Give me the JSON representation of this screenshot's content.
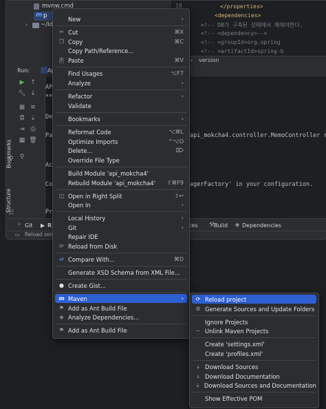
{
  "project_tree": {
    "file_name": "mvnw.cmd",
    "selected_item_prefix": "p",
    "folder_item": "~/Id"
  },
  "editor": {
    "line_number": "18",
    "lines": [
      "</properties>",
      "<dependencies>",
      "<!--      DB가 구축된 상태에서 해줘야한다.",
      "<!--      <dependency>-->",
      "<!--        <groupId>org.spring",
      "<!--        <artifactId>spring-b"
    ],
    "breadcrumb": "version"
  },
  "run_panel": {
    "label": "Run:",
    "tab_prefix": "Ap",
    "console_fragments": [
      "AP",
      "**",
      "De",
      "Pa",
      "api_mokcha4.controller.MemoController r",
      "Ac",
      "Co",
      "agerFactory' in your configuration.",
      "Pr"
    ]
  },
  "side_labels": {
    "bookmarks": "Bookmarks",
    "structure": "Structure"
  },
  "bottom_tabs": {
    "git": "Git",
    "run_prefix": "R",
    "services_suffix": "ces",
    "build": "Build",
    "dependencies": "Dependencies"
  },
  "status_bar": {
    "text": "Reload sele"
  },
  "context_menu": {
    "items": [
      {
        "label": "New",
        "shortcut": "",
        "submenu": true,
        "icon": ""
      },
      {
        "label": "Cut",
        "shortcut": "⌘X",
        "submenu": false,
        "icon": "scissors-icon"
      },
      {
        "label": "Copy",
        "shortcut": "⌘C",
        "submenu": false,
        "icon": "copy-icon"
      },
      {
        "label": "Copy Path/Reference...",
        "shortcut": "",
        "submenu": false,
        "icon": ""
      },
      {
        "label": "Paste",
        "shortcut": "⌘V",
        "submenu": false,
        "icon": "paste-icon"
      },
      {
        "label": "Find Usages",
        "shortcut": "⌥F7",
        "submenu": false,
        "icon": ""
      },
      {
        "label": "Analyze",
        "shortcut": "",
        "submenu": true,
        "icon": ""
      },
      {
        "label": "Refactor",
        "shortcut": "",
        "submenu": true,
        "icon": ""
      },
      {
        "label": "Validate",
        "shortcut": "",
        "submenu": false,
        "icon": ""
      },
      {
        "label": "Bookmarks",
        "shortcut": "",
        "submenu": true,
        "icon": ""
      },
      {
        "label": "Reformat Code",
        "shortcut": "⌥⌘L",
        "submenu": false,
        "icon": ""
      },
      {
        "label": "Optimize Imports",
        "shortcut": "^⌥O",
        "submenu": false,
        "icon": ""
      },
      {
        "label": "Delete...",
        "shortcut": "⌦",
        "submenu": false,
        "icon": ""
      },
      {
        "label": "Override File Type",
        "shortcut": "",
        "submenu": false,
        "icon": ""
      },
      {
        "label": "Build Module 'api_mokcha4'",
        "shortcut": "",
        "submenu": false,
        "icon": ""
      },
      {
        "label": "Rebuild Module 'api_mokcha4'",
        "shortcut": "⇧⌘F9",
        "submenu": false,
        "icon": ""
      },
      {
        "label": "Open in Right Split",
        "shortcut": "⇧↩",
        "submenu": false,
        "icon": "split-icon"
      },
      {
        "label": "Open In",
        "shortcut": "",
        "submenu": true,
        "icon": ""
      },
      {
        "label": "Local History",
        "shortcut": "",
        "submenu": true,
        "icon": ""
      },
      {
        "label": "Git",
        "shortcut": "",
        "submenu": true,
        "icon": ""
      },
      {
        "label": "Repair IDE",
        "shortcut": "",
        "submenu": false,
        "icon": ""
      },
      {
        "label": "Reload from Disk",
        "shortcut": "",
        "submenu": false,
        "icon": "reload-icon"
      },
      {
        "label": "Compare With...",
        "shortcut": "⌘D",
        "submenu": false,
        "icon": "compare-icon"
      },
      {
        "label": "Generate XSD Schema from XML File...",
        "shortcut": "",
        "submenu": false,
        "icon": ""
      },
      {
        "label": "Create Gist...",
        "shortcut": "",
        "submenu": false,
        "icon": "github-icon"
      },
      {
        "label": "Maven",
        "shortcut": "",
        "submenu": true,
        "icon": "maven-icon"
      },
      {
        "label": "Add as Ant Build File",
        "shortcut": "",
        "submenu": false,
        "icon": "ant-icon"
      },
      {
        "label": "Analyze Dependencies...",
        "shortcut": "",
        "submenu": false,
        "icon": "dependencies-icon"
      },
      {
        "label": "Add as Ant Build File",
        "shortcut": "",
        "submenu": false,
        "icon": "ant-icon"
      }
    ]
  },
  "maven_submenu": {
    "items": [
      {
        "label": "Reload project",
        "icon": "reload-icon"
      },
      {
        "label": "Generate Sources and Update Folders",
        "icon": "generate-icon"
      },
      {
        "label": "Ignore Projects",
        "icon": ""
      },
      {
        "label": "Unlink Maven Projects",
        "icon": "minus-icon"
      },
      {
        "label": "Create 'settings.xml'",
        "icon": ""
      },
      {
        "label": "Create 'profiles.xml'",
        "icon": ""
      },
      {
        "label": "Download Sources",
        "icon": "download-icon"
      },
      {
        "label": "Download Documentation",
        "icon": "download-icon"
      },
      {
        "label": "Download Sources and Documentation",
        "icon": "download-icon"
      },
      {
        "label": "Show Effective POM",
        "icon": ""
      }
    ]
  },
  "colors": {
    "highlight": "#2e5fd1",
    "menu_bg": "#2b2d30",
    "editor_bg": "#1e1f22",
    "xml_tag": "#d5b778",
    "comment": "#7a7e85"
  }
}
